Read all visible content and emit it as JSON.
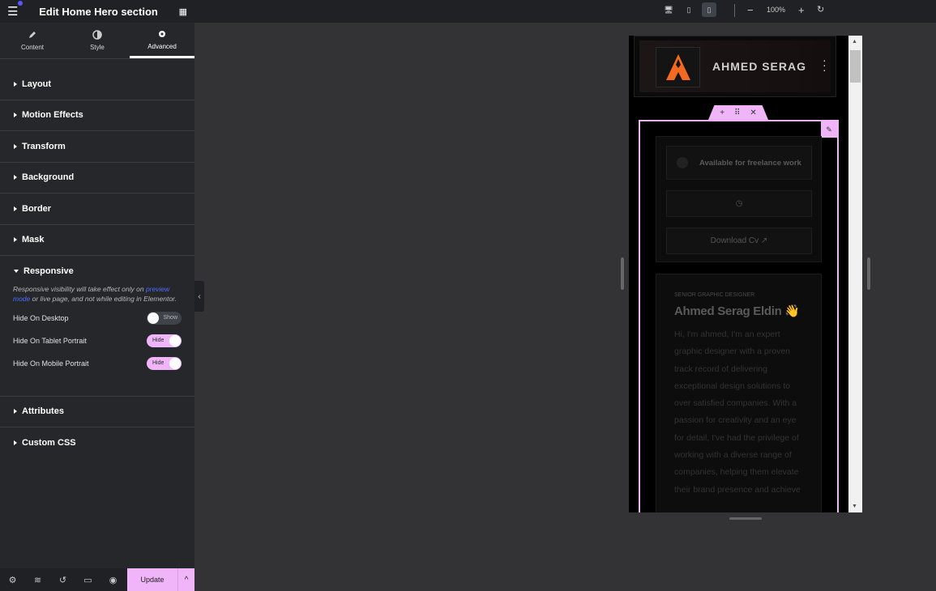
{
  "panel": {
    "title": "Edit Home Hero section",
    "tabs": [
      {
        "label": "Content"
      },
      {
        "label": "Style"
      },
      {
        "label": "Advanced"
      }
    ],
    "sections": [
      "Layout",
      "Motion Effects",
      "Transform",
      "Background",
      "Border",
      "Mask",
      "Responsive"
    ],
    "responsive": {
      "note_before": "Responsive visibility will take effect only on ",
      "note_link": "preview mode",
      "note_after": " or live page, and not while editing in Elementor.",
      "toggles": [
        {
          "label": "Hide On Desktop",
          "state": "Show",
          "on": false
        },
        {
          "label": "Hide On Tablet Portrait",
          "state": "Hide",
          "on": true
        },
        {
          "label": "Hide On Mobile Portrait",
          "state": "Hide",
          "on": true
        }
      ]
    },
    "sections_after": [
      "Attributes",
      "Custom CSS"
    ],
    "footer": {
      "update": "Update"
    }
  },
  "topbar": {
    "zoom": "100%"
  },
  "preview": {
    "brand": "AHMED SERAG",
    "freelance": "Available for freelance work",
    "download": "Download Cv ↗",
    "role": "SENIOR GRAPHIC DESIGNER",
    "name": "Ahmed Serag Eldin 👋",
    "bio": "Hi, I'm ahmed, I'm an expert graphic designer with a proven track record of delivering exceptional design solutions to over satisfied companies. With a passion for creativity and an eye for detail, I've had the privilege of working with a diverse range of companies, helping them elevate their brand presence and achieve"
  },
  "colors": {
    "accent": "#f0b5f9",
    "link": "#4c6cff",
    "logo": "#f26a21"
  }
}
